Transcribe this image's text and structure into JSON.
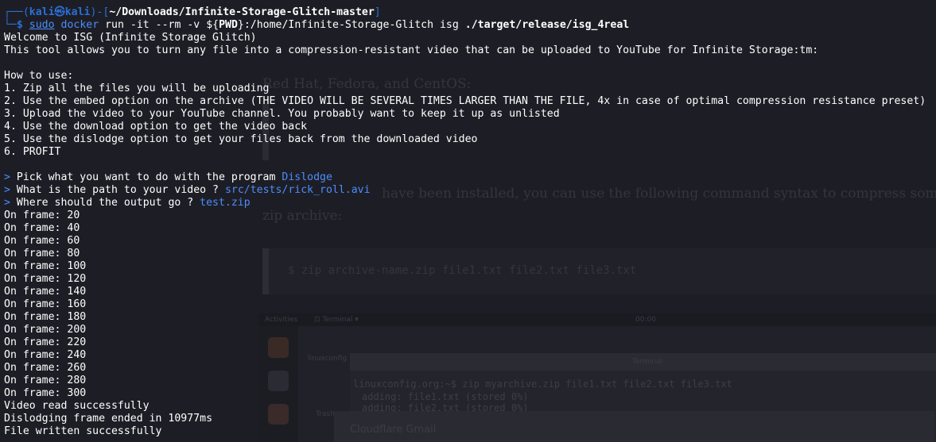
{
  "prompt": {
    "user": "kali",
    "at_symbol": "㉿",
    "host": "kali",
    "cwd": "~/Downloads/Infinite-Storage-Glitch-master",
    "dollar": "$"
  },
  "command": {
    "sudo": "sudo",
    "docker": "docker",
    "run": "run",
    "flags": "-it --rm -v",
    "var_open": "${",
    "var_name": "PWD",
    "var_close": "}",
    "mount": ":/home/Infinite-Storage-Glitch isg",
    "binary": "./target/release/isg_4real"
  },
  "output": {
    "welcome": "Welcome to ISG (Infinite Storage Glitch)",
    "intro": "This tool allows you to turn any file into a compression-resistant video that can be uploaded to YouTube for Infinite Storage:tm:",
    "how_to": "How to use:",
    "steps": [
      "1. Zip all the files you will be uploading",
      "2. Use the embed option on the archive (THE VIDEO WILL BE SEVERAL TIMES LARGER THAN THE FILE, 4x in case of optimal compression resistance preset)",
      "3. Upload the video to your YouTube channel. You probably want to keep it up as unlisted",
      "4. Use the download option to get the video back",
      "5. Use the dislodge option to get your files back from the downloaded video",
      "6. PROFIT"
    ],
    "questions": [
      {
        "marker": ">",
        "question": "Pick what you want to do with the program",
        "answer": "Dislodge"
      },
      {
        "marker": ">",
        "question": "What is the path to your video ?",
        "answer": "src/tests/rick_roll.avi"
      },
      {
        "marker": ">",
        "question": "Where should the output go ?",
        "answer": "test.zip"
      }
    ],
    "frames": [
      "On frame: 20",
      "On frame: 40",
      "On frame: 60",
      "On frame: 80",
      "On frame: 100",
      "On frame: 120",
      "On frame: 140",
      "On frame: 160",
      "On frame: 180",
      "On frame: 200",
      "On frame: 220",
      "On frame: 240",
      "On frame: 260",
      "On frame: 280",
      "On frame: 300"
    ],
    "video_read": "Video read successfully",
    "dislodge_time": "Dislodging frame ended in 10977ms",
    "file_written": "File written successfully"
  },
  "colors": {
    "background": "#1d1e25",
    "prompt_blue": "#2a6fd6",
    "command_blue": "#4c8cff",
    "text": "#ffffff"
  }
}
